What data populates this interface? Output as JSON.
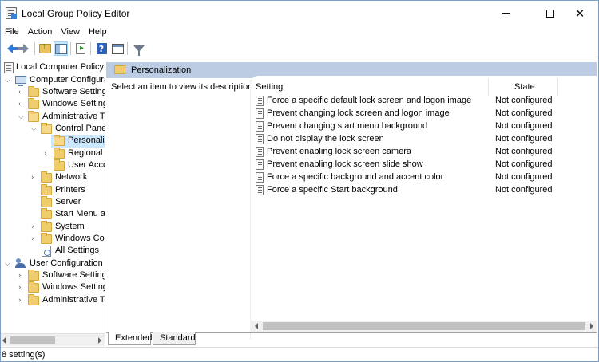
{
  "window": {
    "title": "Local Group Policy Editor",
    "minimize": "",
    "maximize": "",
    "close": "✕"
  },
  "menu": [
    "File",
    "Action",
    "View",
    "Help"
  ],
  "toolbar": {
    "icons": [
      "back-arrow-icon",
      "forward-arrow-icon",
      "up-folder-icon",
      "show-hide-pane-icon",
      "export-list-icon",
      "help-icon",
      "properties-icon",
      "filter-icon"
    ]
  },
  "tree": {
    "root": "Local Computer Policy",
    "computer_config": "Computer Configura",
    "cc_software": "Software Settings",
    "cc_windows": "Windows Setting",
    "cc_admin": "Administrative Te",
    "control_panel": "Control Panel",
    "personalization": "Personaliz",
    "regional": "Regional a",
    "user_accounts": "User Acco",
    "network": "Network",
    "printers": "Printers",
    "server": "Server",
    "start_menu": "Start Menu ar",
    "system": "System",
    "windows_comp": "Windows Cor",
    "all_settings": "All Settings",
    "user_config": "User Configuration",
    "uc_software": "Software Settings",
    "uc_windows": "Windows Setting",
    "uc_admin": "Administrative Te"
  },
  "right": {
    "header_title": "Personalization",
    "description": "Select an item to view its description.",
    "columns": {
      "setting": "Setting",
      "state": "State"
    },
    "settings": [
      {
        "name": "Force a specific default lock screen and logon image",
        "state": "Not configured"
      },
      {
        "name": "Prevent changing lock screen and logon image",
        "state": "Not configured"
      },
      {
        "name": "Prevent changing start menu background",
        "state": "Not configured"
      },
      {
        "name": "Do not display the lock screen",
        "state": "Not configured"
      },
      {
        "name": "Prevent enabling lock screen camera",
        "state": "Not configured"
      },
      {
        "name": "Prevent enabling lock screen slide show",
        "state": "Not configured"
      },
      {
        "name": "Force a specific background and accent color",
        "state": "Not configured"
      },
      {
        "name": "Force a specific Start background",
        "state": "Not configured"
      }
    ],
    "tabs": {
      "extended": "Extended",
      "standard": "Standard"
    }
  },
  "status": "8 setting(s)"
}
